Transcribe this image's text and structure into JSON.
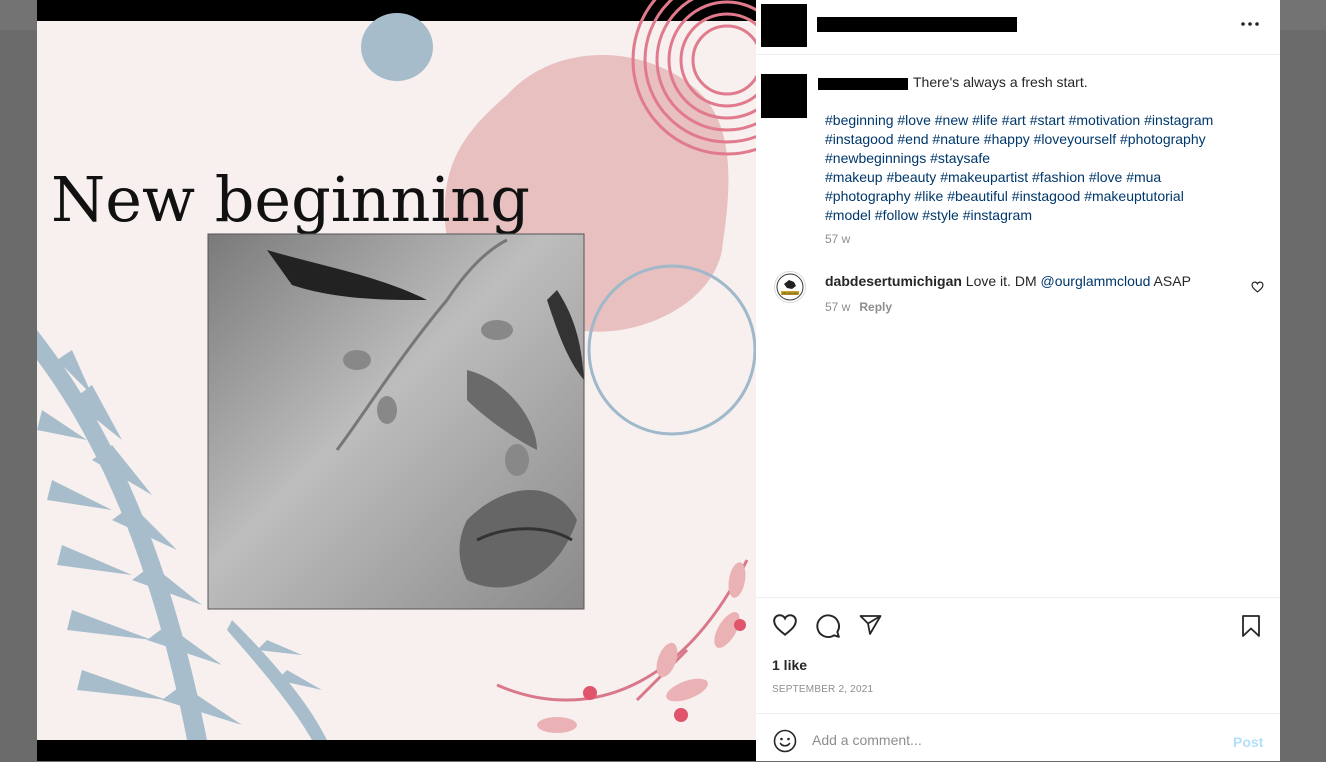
{
  "post": {
    "image_title": "New beginning",
    "caption": "There's always a fresh start.",
    "hashtag_lines": [
      "#beginning #love #new #life #art #start #motivation #instagram",
      "#instagood #end #nature #happy #loveyourself #photography",
      "#newbeginnings #staysafe",
      "#makeup #beauty #makeupartist #fashion #love #mua",
      "#photography #like #beautiful #instagood #makeuptutorial",
      "#model #follow #style #instagram"
    ],
    "caption_time": "57 w",
    "avatar_badge_text": "MICHIGAN"
  },
  "comments": [
    {
      "username": "dabdesertumichigan",
      "text_before": " Love it. DM ",
      "mention": "@ourglammcloud",
      "text_after": " ASAP",
      "time": "57 w",
      "reply_label": "Reply"
    }
  ],
  "actions": {
    "likes": "1 like",
    "date": "SEPTEMBER 2, 2021"
  },
  "comment_box": {
    "placeholder": "Add a comment...",
    "post_label": "Post"
  },
  "colors": {
    "link": "#00376b",
    "muted": "#8e8e8e",
    "post_disabled": "#b2dffc"
  },
  "icons": [
    "more-icon",
    "heart-icon",
    "comment-icon",
    "share-icon",
    "bookmark-icon",
    "emoji-icon"
  ]
}
